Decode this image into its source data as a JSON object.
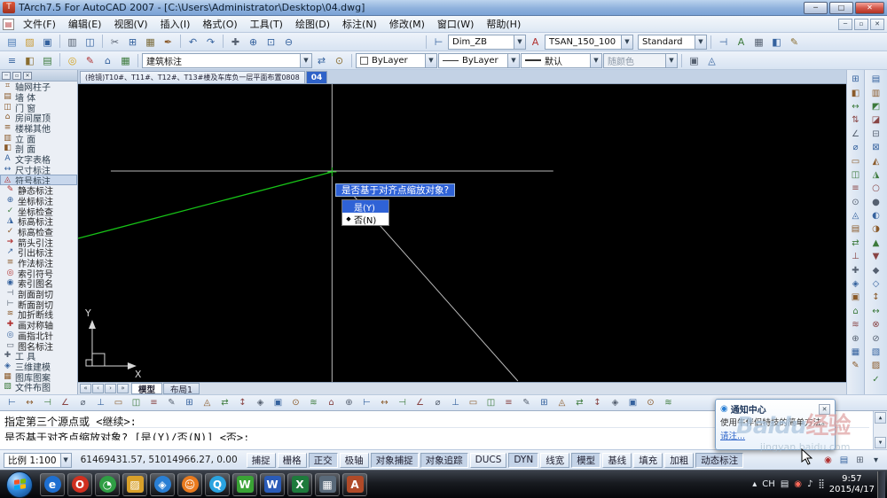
{
  "titlebar": {
    "app_glyph": "T",
    "title": "TArch7.5 For AutoCAD 2007 - [C:\\Users\\Administrator\\Desktop\\04.dwg]",
    "buttons": {
      "minimize": "─",
      "maximize": "□",
      "close": "✕"
    }
  },
  "menubar": {
    "doc_glyph": "▤",
    "items": [
      "文件(F)",
      "编辑(E)",
      "视图(V)",
      "插入(I)",
      "格式(O)",
      "工具(T)",
      "绘图(D)",
      "标注(N)",
      "修改(M)",
      "窗口(W)",
      "帮助(H)"
    ],
    "child_buttons": [
      "─",
      "▫",
      "✕"
    ]
  },
  "toolbar1": {
    "left_icons": [
      {
        "n": "new-file-icon",
        "g": "▤",
        "c": "#4a7ab5"
      },
      {
        "n": "open-folder-icon",
        "g": "▨",
        "c": "#c99a33"
      },
      {
        "n": "save-icon",
        "g": "▣",
        "c": "#35629e"
      },
      {
        "n": "sep"
      },
      {
        "n": "plot-icon",
        "g": "▥",
        "c": "#556070"
      },
      {
        "n": "plot-preview-icon",
        "g": "◫",
        "c": "#35629e"
      },
      {
        "n": "sep"
      },
      {
        "n": "cut-icon",
        "g": "✂",
        "c": "#556070"
      },
      {
        "n": "copy-icon",
        "g": "⊞",
        "c": "#35629e"
      },
      {
        "n": "paste-icon",
        "g": "▦",
        "c": "#7a6a3a"
      },
      {
        "n": "match-properties-icon",
        "g": "✒",
        "c": "#8a5a2a"
      },
      {
        "n": "sep"
      },
      {
        "n": "undo-icon",
        "g": "↶",
        "c": "#35629e"
      },
      {
        "n": "redo-icon",
        "g": "↷",
        "c": "#35629e"
      },
      {
        "n": "sep"
      },
      {
        "n": "pan-icon",
        "g": "✚",
        "c": "#556070"
      },
      {
        "n": "zoom-realtime-icon",
        "g": "⊕",
        "c": "#35629e"
      },
      {
        "n": "zoom-window-icon",
        "g": "⊡",
        "c": "#35629e"
      },
      {
        "n": "zoom-previous-icon",
        "g": "⊖",
        "c": "#35629e"
      }
    ],
    "dim_style_icon": {
      "n": "dim-style-icon",
      "g": "⊢",
      "c": "#35629e"
    },
    "dim_style": "Dim_ZB",
    "text_style_icon": {
      "n": "text-style-icon",
      "g": "A",
      "c": "#b03030"
    },
    "text_style": "TSAN_150_100",
    "table_style": "Standard",
    "right_icons": [
      {
        "n": "dim-edit-icon",
        "g": "⊣",
        "c": "#35629e"
      },
      {
        "n": "text-edit-icon",
        "g": "A",
        "c": "#3c7a3c"
      },
      {
        "n": "table-icon",
        "g": "▦",
        "c": "#556070"
      },
      {
        "n": "style-manager-icon",
        "g": "◧",
        "c": "#35629e"
      },
      {
        "n": "annotation-edit-icon",
        "g": "✎",
        "c": "#8a6d2f"
      }
    ]
  },
  "toolbar2": {
    "left_icons": [
      {
        "n": "layer-manager-icon",
        "g": "≡",
        "c": "#35629e"
      },
      {
        "n": "layer-states-icon",
        "g": "◧",
        "c": "#8a6d2f"
      },
      {
        "n": "layer-previous-icon",
        "g": "▤",
        "c": "#3c7a3c"
      },
      {
        "n": "sep"
      },
      {
        "n": "bulb-icon",
        "g": "◎",
        "c": "#d4a017"
      },
      {
        "n": "pencil-icon",
        "g": "✎",
        "c": "#b03030"
      },
      {
        "n": "house-icon",
        "g": "⌂",
        "c": "#35629e"
      },
      {
        "n": "grid-icon",
        "g": "▦",
        "c": "#3c7a3c"
      }
    ],
    "annotation_combo": "建筑标注",
    "mid_icons": [
      {
        "n": "swap-icon",
        "g": "⇄",
        "c": "#35629e"
      },
      {
        "n": "target-icon",
        "g": "⊙",
        "c": "#8a6d2f"
      }
    ],
    "color_label": "ByLayer",
    "linetype_label": "ByLayer",
    "lineweight_label": "默认",
    "plotstyle_label": "随颜色",
    "right_icons": [
      {
        "n": "properties-icon",
        "g": "▣",
        "c": "#556070"
      },
      {
        "n": "tool-palette-icon",
        "g": "◬",
        "c": "#35629e"
      }
    ]
  },
  "palette": {
    "head_buttons": [
      "─",
      "▫",
      "✕"
    ],
    "sections": [
      {
        "label": "轴网柱子",
        "g": "⌗",
        "c": "#8a5a2a"
      },
      {
        "label": "墙 体",
        "g": "▤",
        "c": "#8a5a2a"
      },
      {
        "label": "门 窗",
        "g": "◫",
        "c": "#8a5a2a"
      },
      {
        "label": "房间屋顶",
        "g": "⌂",
        "c": "#8a5a2a"
      },
      {
        "label": "楼梯其他",
        "g": "≡",
        "c": "#8a5a2a"
      },
      {
        "label": "立 面",
        "g": "▥",
        "c": "#8a5a2a"
      },
      {
        "label": "剖 面",
        "g": "◧",
        "c": "#8a5a2a"
      },
      {
        "label": "文字表格",
        "g": "A",
        "c": "#35629e"
      },
      {
        "label": "尺寸标注",
        "g": "↔",
        "c": "#35629e"
      },
      {
        "label": "符号标注",
        "g": "◬",
        "c": "#b03030",
        "active": true
      }
    ],
    "items": [
      {
        "label": "静态标注",
        "g": "✎",
        "c": "#b03030"
      },
      {
        "label": "坐标标注",
        "g": "⊕",
        "c": "#35629e"
      },
      {
        "label": "坐标检查",
        "g": "✓",
        "c": "#3c7a3c"
      },
      {
        "label": "标高标注",
        "g": "◮",
        "c": "#35629e"
      },
      {
        "label": "标高检查",
        "g": "✓",
        "c": "#8a5a2a"
      },
      {
        "label": "箭头引注",
        "g": "➔",
        "c": "#b03030"
      },
      {
        "label": "引出标注",
        "g": "↗",
        "c": "#35629e"
      },
      {
        "label": "作法标注",
        "g": "≡",
        "c": "#8a5a2a"
      },
      {
        "label": "索引符号",
        "g": "◎",
        "c": "#b03030"
      },
      {
        "label": "索引图名",
        "g": "◉",
        "c": "#35629e"
      },
      {
        "label": "剖面剖切",
        "g": "⊣",
        "c": "#556070"
      },
      {
        "label": "断面剖切",
        "g": "⊢",
        "c": "#556070"
      },
      {
        "label": "加折断线",
        "g": "≋",
        "c": "#8a5a2a"
      },
      {
        "label": "画对称轴",
        "g": "✚",
        "c": "#b03030"
      },
      {
        "label": "画指北针",
        "g": "◎",
        "c": "#35629e"
      },
      {
        "label": "图名标注",
        "g": "▭",
        "c": "#556070"
      }
    ],
    "footer": [
      {
        "label": "工 具",
        "g": "✚",
        "c": "#556070"
      },
      {
        "label": "三维建模",
        "g": "◈",
        "c": "#35629e"
      },
      {
        "label": "图库图案",
        "g": "▦",
        "c": "#8a5a2a"
      },
      {
        "label": "文件布图",
        "g": "▧",
        "c": "#3c7a3c"
      }
    ]
  },
  "docbar": {
    "tab1": "(抢镜)T10#、T11#、T12#、T13#楼及车库负一层平面布置0808",
    "tab2": "04"
  },
  "canvas": {
    "popup_title": "是否基于对齐点缩放对象?",
    "popup_items": [
      {
        "label": "是(Y)",
        "selected": true
      },
      {
        "label": "否(N)",
        "selected": false,
        "bullet": "◆"
      }
    ],
    "ucs_x": "X",
    "ucs_y": "Y"
  },
  "model_tabs": {
    "arrows": [
      "«",
      "‹",
      "›",
      "»"
    ],
    "tabs": [
      {
        "label": "模型",
        "active": true
      },
      {
        "label": "布局1",
        "active": false
      }
    ]
  },
  "vtoolbar1": {
    "glyphs": [
      "⊞",
      "◧",
      "↔",
      "⇅",
      "∠",
      "⌀",
      "▭",
      "◫",
      "≡",
      "⊙",
      "◬",
      "▤",
      "⇄",
      "⊥",
      "✚",
      "◈",
      "▣",
      "⌂",
      "≋",
      "⊕",
      "▦",
      "✎"
    ]
  },
  "vtoolbar2": {
    "glyphs": [
      "▤",
      "▥",
      "◩",
      "◪",
      "⊟",
      "⊠",
      "◭",
      "◮",
      "○",
      "●",
      "◐",
      "◑",
      "▲",
      "▼",
      "◆",
      "◇",
      "↕",
      "↔",
      "⊗",
      "⊘",
      "▧",
      "▨",
      "✓"
    ]
  },
  "htoolbar": {
    "glyphs": [
      "⊢",
      "↔",
      "⊣",
      "∠",
      "⌀",
      "⊥",
      "▭",
      "◫",
      "≡",
      "✎",
      "⊞",
      "◬",
      "⇄",
      "↕",
      "◈",
      "▣",
      "⊙",
      "≋",
      "⌂",
      "⊕",
      "⊢",
      "↔",
      "⊣",
      "∠",
      "⌀",
      "⊥",
      "▭",
      "◫",
      "≡",
      "✎",
      "⊞",
      "◬",
      "⇄",
      "↕",
      "◈",
      "▣",
      "⊙",
      "≋"
    ]
  },
  "command": {
    "line1": "指定第三个源点或 <继续>:",
    "line2": "是否基于对齐点缩放对象? [是(Y)/否(N)] <否>:"
  },
  "statusbar": {
    "scale_label": "比例 1:100",
    "coords": "61469431.57, 51014966.27, 0.00",
    "buttons": [
      {
        "label": "捕捉",
        "pressed": false
      },
      {
        "label": "栅格",
        "pressed": false
      },
      {
        "label": "正交",
        "pressed": true
      },
      {
        "label": "极轴",
        "pressed": false
      },
      {
        "label": "对象捕捉",
        "pressed": true
      },
      {
        "label": "对象追踪",
        "pressed": true
      },
      {
        "label": "DUCS",
        "pressed": false
      },
      {
        "label": "DYN",
        "pressed": true
      },
      {
        "label": "线宽",
        "pressed": false
      },
      {
        "label": "模型",
        "pressed": true
      },
      {
        "label": "基线",
        "pressed": false
      },
      {
        "label": "填充",
        "pressed": false
      },
      {
        "label": "加粗",
        "pressed": false
      },
      {
        "label": "动态标注",
        "pressed": true
      }
    ],
    "right_icons": [
      {
        "n": "annotation-scale-icon",
        "g": "◉",
        "c": "#b03030"
      },
      {
        "n": "comm-center-icon",
        "g": "▤",
        "c": "#35629e"
      },
      {
        "n": "clean-screen-icon",
        "g": "⊞",
        "c": "#556070"
      },
      {
        "n": "status-menu-arrow-icon",
        "g": "▾",
        "c": "#345"
      }
    ]
  },
  "taskbar": {
    "icons": [
      {
        "n": "ie-icon",
        "g": "e",
        "bg": "#1e6fd0",
        "shape": "circle"
      },
      {
        "n": "opera-icon",
        "g": "O",
        "bg": "#d03020",
        "shape": "circle"
      },
      {
        "n": "chrome-icon",
        "g": "◔",
        "bg": "#2f9e44",
        "shape": "circle"
      },
      {
        "n": "folder-icon",
        "g": "▨",
        "bg": "#d8a02a",
        "shape": "square"
      },
      {
        "n": "browser-icon",
        "g": "◈",
        "bg": "#2a7fd4",
        "shape": "circle"
      },
      {
        "n": "naruto-icon",
        "g": "☺",
        "bg": "#e87a1e",
        "shape": "circle"
      },
      {
        "n": "qq-icon",
        "g": "Q",
        "bg": "#2aa3e0",
        "shape": "circle"
      },
      {
        "n": "wechat-icon",
        "g": "W",
        "bg": "#3aa335",
        "shape": "square"
      },
      {
        "n": "word-icon",
        "g": "W",
        "bg": "#2a5bb8",
        "shape": "square"
      },
      {
        "n": "excel-icon",
        "g": "X",
        "bg": "#1e7a3c",
        "shape": "square"
      },
      {
        "n": "cad-drawing-icon",
        "g": "▦",
        "bg": "#5a6a7a",
        "shape": "square"
      },
      {
        "n": "tarch-icon",
        "g": "A",
        "bg": "#b04a28",
        "shape": "square"
      }
    ],
    "tray": [
      {
        "n": "expand-icon",
        "g": "▴"
      },
      {
        "n": "language-indicator",
        "g": "CH"
      },
      {
        "n": "keyboard-icon",
        "g": "▤"
      },
      {
        "n": "shield-icon",
        "g": "◉",
        "c": "#ff6a5a"
      },
      {
        "n": "volume-icon",
        "g": "♪"
      },
      {
        "n": "network-icon",
        "g": "⣿"
      }
    ],
    "clock": {
      "time": "9:57",
      "date": "2015/4/17"
    }
  },
  "notification": {
    "icon_glyph": "◉",
    "title": "通知中心",
    "close": "✕",
    "body": "使用牛伴侣特技的简单方法。",
    "link": "请注..."
  },
  "watermark": {
    "brand": "Baidu",
    "suffix": "经验",
    "url": "jingyan.baidu.com"
  }
}
